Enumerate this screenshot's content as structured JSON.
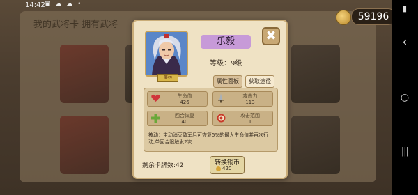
{
  "status_bar": {
    "time": "14:42",
    "icons": "▣ ☁ ☁ •"
  },
  "background": {
    "title": "我的武将卡  拥有武将"
  },
  "currency": {
    "amount": "59196",
    "add_label": "+"
  },
  "dialog": {
    "close_label": "✖",
    "portrait_tag": "美林",
    "name": "乐毅",
    "level_label": "等级：9级",
    "tabs": [
      {
        "label": "属性面板"
      },
      {
        "label": "获取途径"
      }
    ],
    "stats": [
      {
        "label": "生命值",
        "value": "426",
        "icon": "heart-icon"
      },
      {
        "label": "攻击力",
        "value": "113",
        "icon": "sword-icon"
      },
      {
        "label": "回合恢复",
        "value": "40",
        "icon": "cross-icon"
      },
      {
        "label": "攻击范围",
        "value": "1",
        "icon": "target-icon"
      }
    ],
    "passive": "被动：主动消灭敌军后可恢复5%的最大生命值并再次行动,单回合限触发2次",
    "remaining_label": "剩余卡牌数:42",
    "exchange": {
      "label": "转换铜币",
      "cost": "420"
    }
  },
  "colors": {
    "accent_name": "#c79ad8",
    "panel": "#efe2c4",
    "portrait_bg": "#5a86c8"
  }
}
